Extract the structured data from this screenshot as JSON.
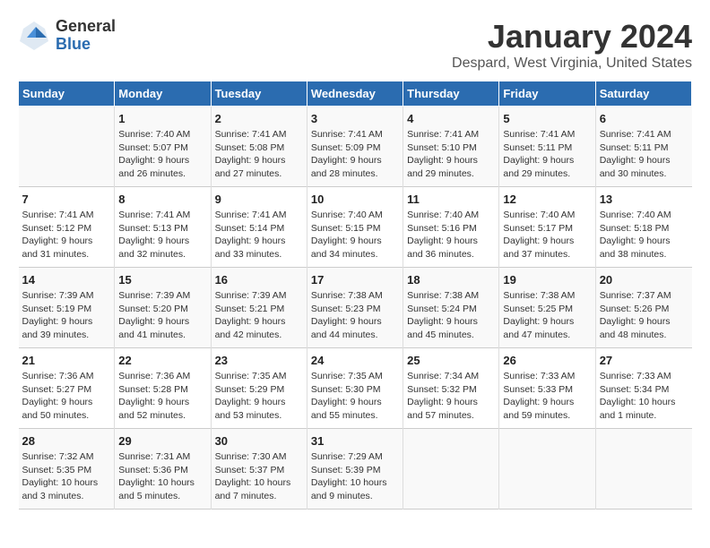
{
  "header": {
    "logo_general": "General",
    "logo_blue": "Blue",
    "month_title": "January 2024",
    "location": "Despard, West Virginia, United States"
  },
  "days_of_week": [
    "Sunday",
    "Monday",
    "Tuesday",
    "Wednesday",
    "Thursday",
    "Friday",
    "Saturday"
  ],
  "weeks": [
    [
      {
        "day": "",
        "info": ""
      },
      {
        "day": "1",
        "info": "Sunrise: 7:40 AM\nSunset: 5:07 PM\nDaylight: 9 hours\nand 26 minutes."
      },
      {
        "day": "2",
        "info": "Sunrise: 7:41 AM\nSunset: 5:08 PM\nDaylight: 9 hours\nand 27 minutes."
      },
      {
        "day": "3",
        "info": "Sunrise: 7:41 AM\nSunset: 5:09 PM\nDaylight: 9 hours\nand 28 minutes."
      },
      {
        "day": "4",
        "info": "Sunrise: 7:41 AM\nSunset: 5:10 PM\nDaylight: 9 hours\nand 29 minutes."
      },
      {
        "day": "5",
        "info": "Sunrise: 7:41 AM\nSunset: 5:11 PM\nDaylight: 9 hours\nand 29 minutes."
      },
      {
        "day": "6",
        "info": "Sunrise: 7:41 AM\nSunset: 5:11 PM\nDaylight: 9 hours\nand 30 minutes."
      }
    ],
    [
      {
        "day": "7",
        "info": "Sunrise: 7:41 AM\nSunset: 5:12 PM\nDaylight: 9 hours\nand 31 minutes."
      },
      {
        "day": "8",
        "info": "Sunrise: 7:41 AM\nSunset: 5:13 PM\nDaylight: 9 hours\nand 32 minutes."
      },
      {
        "day": "9",
        "info": "Sunrise: 7:41 AM\nSunset: 5:14 PM\nDaylight: 9 hours\nand 33 minutes."
      },
      {
        "day": "10",
        "info": "Sunrise: 7:40 AM\nSunset: 5:15 PM\nDaylight: 9 hours\nand 34 minutes."
      },
      {
        "day": "11",
        "info": "Sunrise: 7:40 AM\nSunset: 5:16 PM\nDaylight: 9 hours\nand 36 minutes."
      },
      {
        "day": "12",
        "info": "Sunrise: 7:40 AM\nSunset: 5:17 PM\nDaylight: 9 hours\nand 37 minutes."
      },
      {
        "day": "13",
        "info": "Sunrise: 7:40 AM\nSunset: 5:18 PM\nDaylight: 9 hours\nand 38 minutes."
      }
    ],
    [
      {
        "day": "14",
        "info": "Sunrise: 7:39 AM\nSunset: 5:19 PM\nDaylight: 9 hours\nand 39 minutes."
      },
      {
        "day": "15",
        "info": "Sunrise: 7:39 AM\nSunset: 5:20 PM\nDaylight: 9 hours\nand 41 minutes."
      },
      {
        "day": "16",
        "info": "Sunrise: 7:39 AM\nSunset: 5:21 PM\nDaylight: 9 hours\nand 42 minutes."
      },
      {
        "day": "17",
        "info": "Sunrise: 7:38 AM\nSunset: 5:23 PM\nDaylight: 9 hours\nand 44 minutes."
      },
      {
        "day": "18",
        "info": "Sunrise: 7:38 AM\nSunset: 5:24 PM\nDaylight: 9 hours\nand 45 minutes."
      },
      {
        "day": "19",
        "info": "Sunrise: 7:38 AM\nSunset: 5:25 PM\nDaylight: 9 hours\nand 47 minutes."
      },
      {
        "day": "20",
        "info": "Sunrise: 7:37 AM\nSunset: 5:26 PM\nDaylight: 9 hours\nand 48 minutes."
      }
    ],
    [
      {
        "day": "21",
        "info": "Sunrise: 7:36 AM\nSunset: 5:27 PM\nDaylight: 9 hours\nand 50 minutes."
      },
      {
        "day": "22",
        "info": "Sunrise: 7:36 AM\nSunset: 5:28 PM\nDaylight: 9 hours\nand 52 minutes."
      },
      {
        "day": "23",
        "info": "Sunrise: 7:35 AM\nSunset: 5:29 PM\nDaylight: 9 hours\nand 53 minutes."
      },
      {
        "day": "24",
        "info": "Sunrise: 7:35 AM\nSunset: 5:30 PM\nDaylight: 9 hours\nand 55 minutes."
      },
      {
        "day": "25",
        "info": "Sunrise: 7:34 AM\nSunset: 5:32 PM\nDaylight: 9 hours\nand 57 minutes."
      },
      {
        "day": "26",
        "info": "Sunrise: 7:33 AM\nSunset: 5:33 PM\nDaylight: 9 hours\nand 59 minutes."
      },
      {
        "day": "27",
        "info": "Sunrise: 7:33 AM\nSunset: 5:34 PM\nDaylight: 10 hours\nand 1 minute."
      }
    ],
    [
      {
        "day": "28",
        "info": "Sunrise: 7:32 AM\nSunset: 5:35 PM\nDaylight: 10 hours\nand 3 minutes."
      },
      {
        "day": "29",
        "info": "Sunrise: 7:31 AM\nSunset: 5:36 PM\nDaylight: 10 hours\nand 5 minutes."
      },
      {
        "day": "30",
        "info": "Sunrise: 7:30 AM\nSunset: 5:37 PM\nDaylight: 10 hours\nand 7 minutes."
      },
      {
        "day": "31",
        "info": "Sunrise: 7:29 AM\nSunset: 5:39 PM\nDaylight: 10 hours\nand 9 minutes."
      },
      {
        "day": "",
        "info": ""
      },
      {
        "day": "",
        "info": ""
      },
      {
        "day": "",
        "info": ""
      }
    ]
  ]
}
